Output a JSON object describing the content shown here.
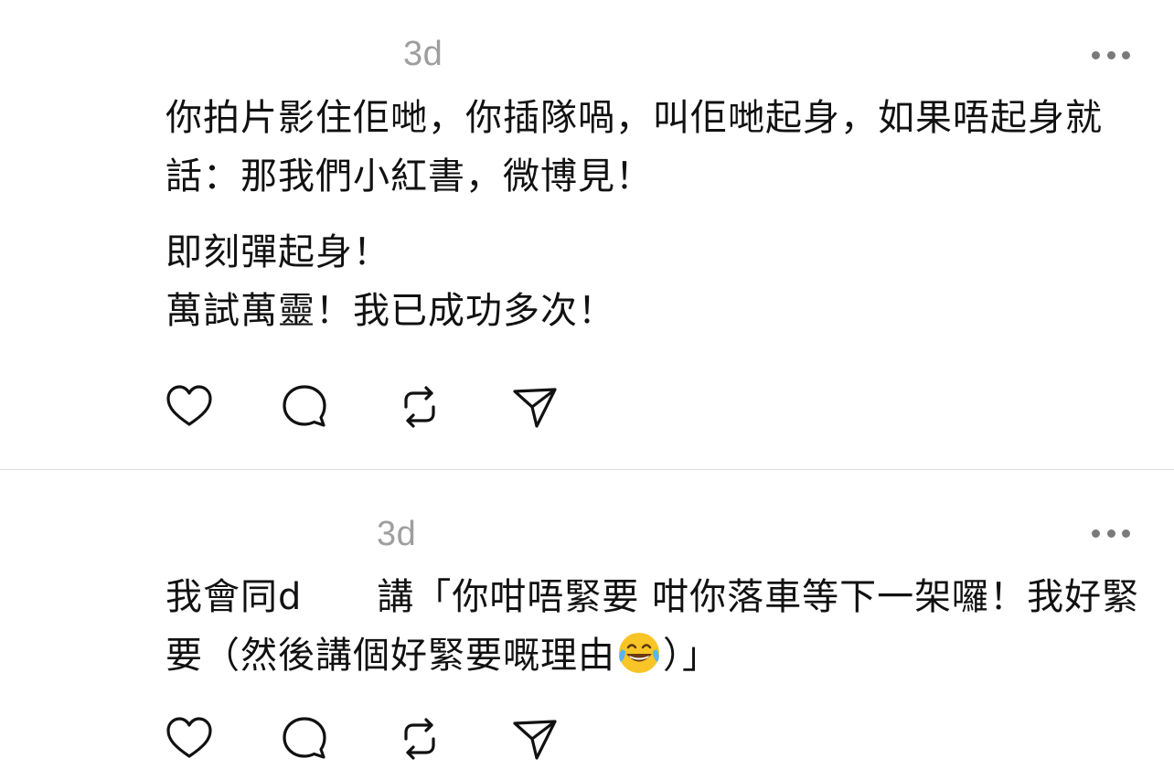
{
  "posts": [
    {
      "timestamp": "3d",
      "paragraphs": [
        "你拍片影住佢哋，你插隊喎，叫佢哋起身，如果唔起身就話：那我們小紅書，微博見！",
        "即刻彈起身！",
        "萬試萬靈！我已成功多次！"
      ],
      "actions": [
        "like-icon",
        "comment-icon",
        "repost-icon",
        "share-icon"
      ]
    },
    {
      "timestamp": "3d",
      "text_before_emoji": "我會同d　　講「你咁唔緊要 咁你落車等下一架囉！我好緊要（然後講個好緊要嘅理由",
      "emoji": "face-with-tears-of-joy",
      "text_after_emoji": "）」",
      "actions": [
        "like-icon",
        "comment-icon",
        "repost-icon",
        "share-icon"
      ]
    }
  ],
  "colors": {
    "text": "#111111",
    "timestamp": "#9e9e9e",
    "more_dots": "#7a7a7a",
    "divider": "#dcdcdc"
  }
}
